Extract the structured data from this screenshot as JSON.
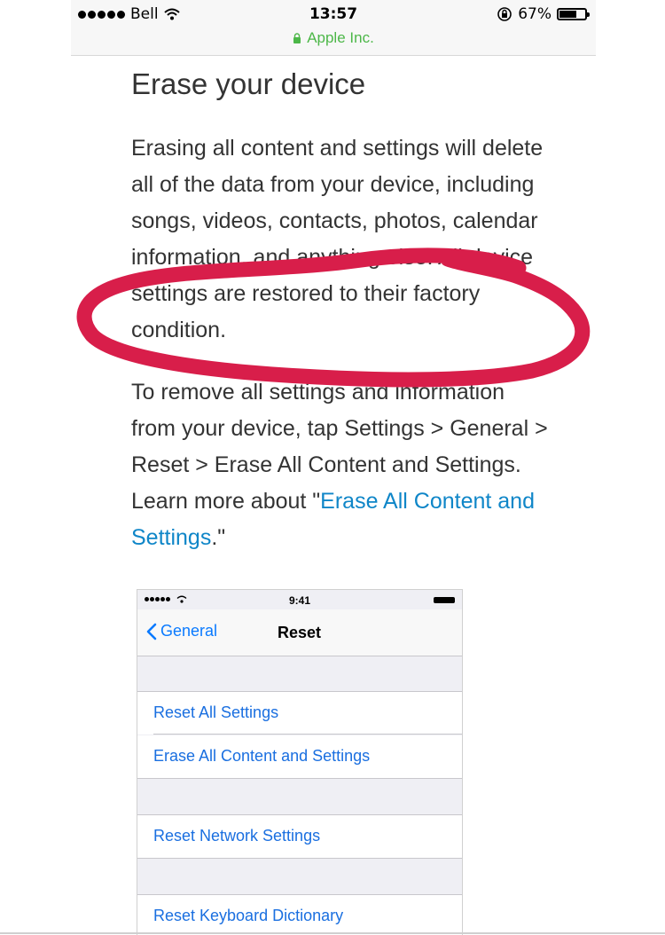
{
  "status_bar": {
    "carrier": "Bell",
    "time": "13:57",
    "battery_percent": "67%",
    "battery_level": 0.67,
    "url": "Apple Inc."
  },
  "article": {
    "heading": "Erase your device",
    "paragraph1": "Erasing all content and settings will delete all of the data from your device, including songs, videos, contacts, photos, calendar information, and anything else. All device settings are restored to their factory condition.",
    "paragraph2_text": "To remove all settings and information from your device, tap Settings > General > Reset > Erase All Content and Settings. Learn more about \"",
    "paragraph2_link": "Erase All Content and Settings",
    "paragraph2_end": ".\""
  },
  "annotation": {
    "color": "#d81e4a"
  },
  "embedded_screenshot": {
    "time": "9:41",
    "back_label": "General",
    "title": "Reset",
    "rows": [
      "Reset All Settings",
      "Erase All Content and Settings",
      "Reset Network Settings",
      "Reset Keyboard Dictionary"
    ]
  },
  "colors": {
    "link": "#0f86c8",
    "secure_url": "#4cb748",
    "ios_blue": "#0a7aff"
  }
}
